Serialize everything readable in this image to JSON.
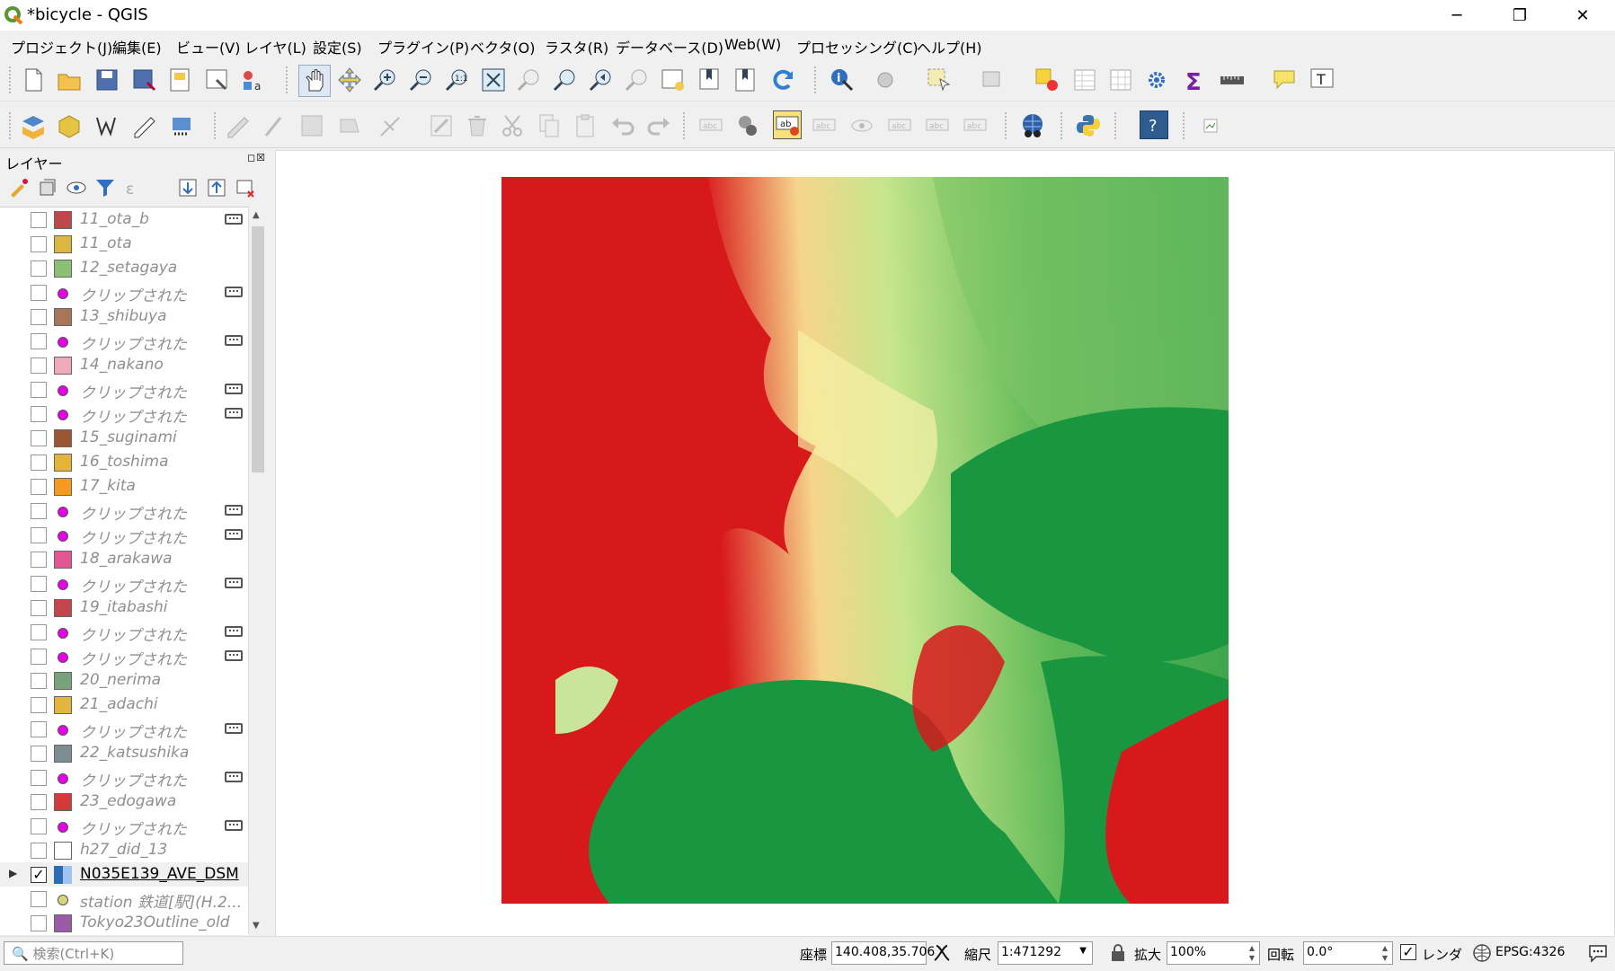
{
  "window": {
    "title": "*bicycle - QGIS",
    "minimize": "─",
    "restore": "❐",
    "close": "✕"
  },
  "menu": [
    "プロジェクト(J)",
    "編集(E)",
    "ビュー(V)",
    "レイヤ(L)",
    "設定(S)",
    "プラグイン(P)",
    "ベクタ(O)",
    "ラスタ(R)",
    "データベース(D)",
    "Web(W)",
    "プロセッシング(C)",
    "ヘルプ(H)"
  ],
  "layers_panel": {
    "title": "レイヤー",
    "buttons": "◻☒",
    "layers": [
      {
        "name": "11_ota_b",
        "kind": "fill",
        "color": "#c0464b",
        "tag": true
      },
      {
        "name": "11_ota",
        "kind": "fill",
        "color": "#dbb73f",
        "tag": false
      },
      {
        "name": "12_setagaya",
        "kind": "fill",
        "color": "#8bbf72",
        "tag": false
      },
      {
        "name": "クリップされた",
        "kind": "point",
        "color": "#e600e6",
        "tag": true
      },
      {
        "name": "13_shibuya",
        "kind": "fill",
        "color": "#a8745a",
        "tag": false
      },
      {
        "name": "クリップされた",
        "kind": "point",
        "color": "#e600e6",
        "tag": true
      },
      {
        "name": "14_nakano",
        "kind": "fill",
        "color": "#f2a8bb",
        "tag": false
      },
      {
        "name": "クリップされた",
        "kind": "point",
        "color": "#e600e6",
        "tag": true
      },
      {
        "name": "クリップされた",
        "kind": "point",
        "color": "#e600e6",
        "tag": true
      },
      {
        "name": "15_suginami",
        "kind": "fill",
        "color": "#9a5532",
        "tag": false
      },
      {
        "name": "16_toshima",
        "kind": "fill",
        "color": "#e4b43a",
        "tag": false
      },
      {
        "name": "17_kita",
        "kind": "fill",
        "color": "#f59a1c",
        "tag": false
      },
      {
        "name": "クリップされた",
        "kind": "point",
        "color": "#e600e6",
        "tag": true
      },
      {
        "name": "クリップされた",
        "kind": "point",
        "color": "#e600e6",
        "tag": true
      },
      {
        "name": "18_arakawa",
        "kind": "fill",
        "color": "#e25694",
        "tag": false
      },
      {
        "name": "クリップされた",
        "kind": "point",
        "color": "#e600e6",
        "tag": true
      },
      {
        "name": "19_itabashi",
        "kind": "fill",
        "color": "#c6454d",
        "tag": false
      },
      {
        "name": "クリップされた",
        "kind": "point",
        "color": "#e600e6",
        "tag": true
      },
      {
        "name": "クリップされた",
        "kind": "point",
        "color": "#e600e6",
        "tag": true
      },
      {
        "name": "20_nerima",
        "kind": "fill",
        "color": "#7aa27a",
        "tag": false
      },
      {
        "name": "21_adachi",
        "kind": "fill",
        "color": "#e2b53e",
        "tag": false
      },
      {
        "name": "クリップされた",
        "kind": "point",
        "color": "#e600e6",
        "tag": true
      },
      {
        "name": "22_katsushika",
        "kind": "fill",
        "color": "#7d8e93",
        "tag": false
      },
      {
        "name": "クリップされた",
        "kind": "point",
        "color": "#e600e6",
        "tag": true
      },
      {
        "name": "23_edogawa",
        "kind": "fill",
        "color": "#d33a3a",
        "tag": false
      },
      {
        "name": "クリップされた",
        "kind": "point",
        "color": "#e600e6",
        "tag": true
      },
      {
        "name": "h27_did_13",
        "kind": "fill",
        "color": "#ffffff",
        "tag": false
      },
      {
        "name": "N035E139_AVE_DSM",
        "kind": "raster",
        "color": "#2d6bb5",
        "tag": false,
        "checked": true,
        "active": true
      },
      {
        "name": "station 鉄道[駅](H.2...",
        "kind": "point",
        "color": "#d9d47a",
        "tag": false
      },
      {
        "name": "Tokyo23Outline_old",
        "kind": "fill",
        "color": "#9b5aa8",
        "tag": false
      }
    ]
  },
  "status": {
    "search_placeholder": "🔍 検索(Ctrl+K)",
    "coord_label": "座標",
    "coord_value": "140.408,35.706",
    "scale_label": "縮尺",
    "scale_value": "1:471292",
    "magnifier_label": "拡大",
    "magnifier_value": "100%",
    "rotation_label": "回転",
    "rotation_value": "0.0°",
    "render_label": "レンダ",
    "crs": "EPSG:4326"
  },
  "colors": {
    "dem_red": "#d7191c",
    "dem_yellow": "#f6f1a8",
    "dem_green": "#1a9641",
    "dem_light_green": "#a6d96a"
  }
}
